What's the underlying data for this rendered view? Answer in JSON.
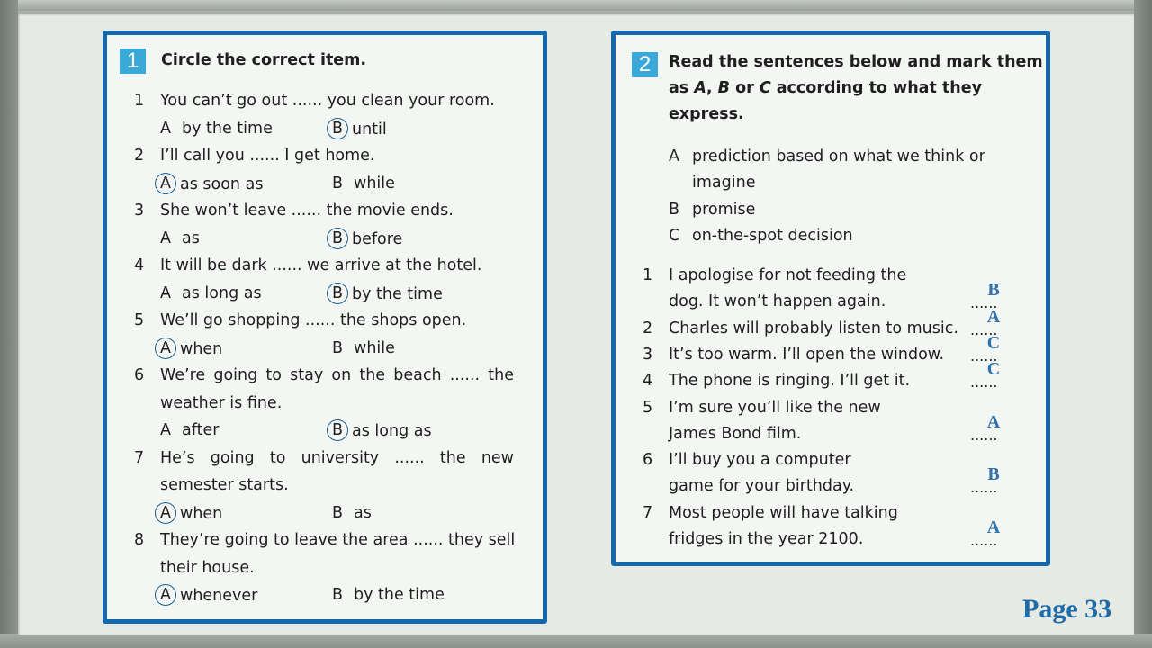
{
  "page_label": "Page 33",
  "exercise1": {
    "number": "1",
    "instruction": "Circle the correct item.",
    "items": [
      {
        "n": "1",
        "lines": [
          "You can’t go out ...... you clean your room."
        ],
        "a": "by the time",
        "b": "until",
        "answer": "B"
      },
      {
        "n": "2",
        "lines": [
          "I’ll call you ...... I get home."
        ],
        "a": "as soon as",
        "b": "while",
        "answer": "A"
      },
      {
        "n": "3",
        "lines": [
          "She won’t leave ...... the movie ends."
        ],
        "a": "as",
        "b": "before",
        "answer": "B"
      },
      {
        "n": "4",
        "lines": [
          "It will be dark ...... we arrive at the hotel."
        ],
        "a": "as long as",
        "b": "by the time",
        "answer": "B"
      },
      {
        "n": "5",
        "lines": [
          "We’ll go shopping ...... the shops open."
        ],
        "a": "when",
        "b": "while",
        "answer": "A"
      },
      {
        "n": "6",
        "lines": [
          "We’re going to stay on the beach ...... the",
          "weather is fine."
        ],
        "a": "after",
        "b": "as long as",
        "answer": "B"
      },
      {
        "n": "7",
        "lines": [
          "He’s going to university ...... the new",
          "semester starts."
        ],
        "a": "when",
        "b": "as",
        "answer": "A"
      },
      {
        "n": "8",
        "lines": [
          "They’re going to leave the area ...... they sell",
          "their house."
        ],
        "a": "whenever",
        "b": "by the time",
        "answer": "A"
      }
    ]
  },
  "exercise2": {
    "number": "2",
    "instruction_lines": [
      "Read the sentences below and mark them",
      "according to what they",
      "express."
    ],
    "instruction_prefix": "as",
    "instruction_letters": [
      "A",
      "B",
      "C"
    ],
    "instruction_or": "or",
    "categories": [
      {
        "letter": "A",
        "lines": [
          "prediction based on what we think or",
          "imagine"
        ]
      },
      {
        "letter": "B",
        "lines": [
          "promise"
        ]
      },
      {
        "letter": "C",
        "lines": [
          "on-the-spot decision"
        ]
      }
    ],
    "dots": "......",
    "items": [
      {
        "n": "1",
        "lines": [
          "I apologise for not feeding the",
          "dog. It won’t happen again."
        ],
        "answer": "B"
      },
      {
        "n": "2",
        "lines": [
          "Charles will probably listen to music."
        ],
        "answer": "A"
      },
      {
        "n": "3",
        "lines": [
          "It’s too warm. I’ll open the window."
        ],
        "answer": "C"
      },
      {
        "n": "4",
        "lines": [
          "The phone is ringing. I’ll get it."
        ],
        "answer": "C"
      },
      {
        "n": "5",
        "lines": [
          "I’m sure you’ll like the new",
          "James Bond film."
        ],
        "answer": "A"
      },
      {
        "n": "6",
        "lines": [
          "I’ll buy you a computer",
          "game for your birthday."
        ],
        "answer": "B"
      },
      {
        "n": "7",
        "lines": [
          "Most people will have talking",
          "fridges in the year 2100."
        ],
        "answer": "A"
      }
    ]
  },
  "colors": {
    "panel_border": "#1767ac",
    "badge": "#3aa9d8",
    "answer_text": "#2f72ad",
    "page_label": "#1f6aa8"
  }
}
